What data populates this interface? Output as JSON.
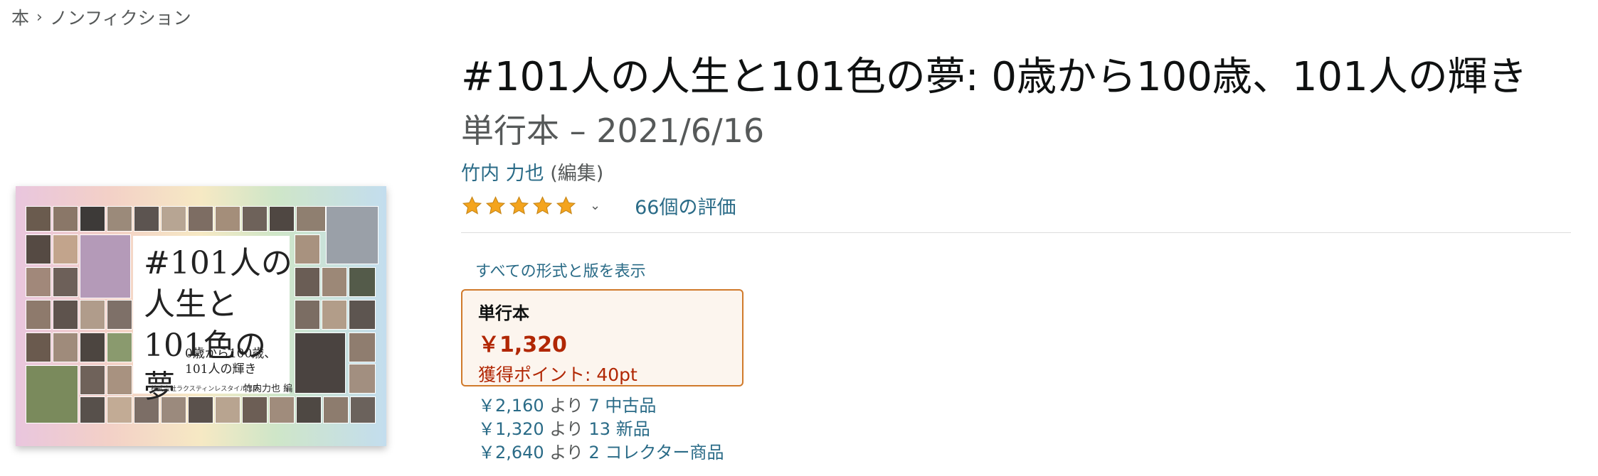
{
  "breadcrumb": {
    "root": "本",
    "separator": "›",
    "category": "ノンフィクション"
  },
  "cover": {
    "title": "#101人の\n人生と\n101色の\n夢",
    "subtitle": "0歳から100歳、\n101人の輝き",
    "publisher": "株式会社ラクスティンレスタイル出版",
    "editor": "竹内力也 編"
  },
  "product": {
    "title": "#101人の人生と101色の夢: 0歳から100歳、101人の輝き",
    "subtitle": "単行本 – 2021/6/16",
    "author_name": "竹内 力也",
    "author_role": "(編集)",
    "rating": 5,
    "rating_max": 5,
    "ratings_count_label": "66個の評価",
    "star_color": "#f4a41d",
    "caret_icon": "chevron-down-icon"
  },
  "formats": {
    "all_formats_link": "すべての形式と版を表示",
    "selected": {
      "name": "単行本",
      "price": "￥1,320",
      "points": "獲得ポイント: 40pt"
    }
  },
  "offers": [
    {
      "price": "￥2,160",
      "from": "より",
      "link": "7 中古品"
    },
    {
      "price": "￥1,320",
      "from": "より",
      "link": "13 新品"
    },
    {
      "price": "￥2,640",
      "from": "より",
      "link": "2 コレクター商品"
    }
  ],
  "colors": {
    "link": "#2a6b87",
    "price": "#b12704",
    "card_border": "#d07a2b",
    "card_background": "#fcf5ee"
  }
}
